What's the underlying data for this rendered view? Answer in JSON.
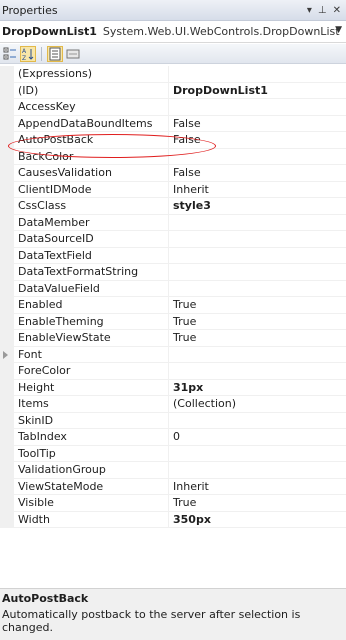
{
  "window": {
    "title": "Properties"
  },
  "object_selector": {
    "name": "DropDownList1",
    "type": "System.Web.UI.WebControls.DropDownList"
  },
  "toolbar": {
    "buttons": [
      {
        "icon": "categorized-icon"
      },
      {
        "icon": "alphabetical-icon"
      },
      {
        "icon": "properties-icon"
      },
      {
        "icon": "events-icon"
      }
    ]
  },
  "properties": [
    {
      "name": "(Expressions)",
      "value": ""
    },
    {
      "name": "(ID)",
      "value": "DropDownList1",
      "bold": true
    },
    {
      "name": "AccessKey",
      "value": ""
    },
    {
      "name": "AppendDataBoundItems",
      "value": "False"
    },
    {
      "name": "AutoPostBack",
      "value": "False",
      "selected": true
    },
    {
      "name": "BackColor",
      "value": ""
    },
    {
      "name": "CausesValidation",
      "value": "False"
    },
    {
      "name": "ClientIDMode",
      "value": "Inherit"
    },
    {
      "name": "CssClass",
      "value": "style3",
      "bold": true
    },
    {
      "name": "DataMember",
      "value": ""
    },
    {
      "name": "DataSourceID",
      "value": ""
    },
    {
      "name": "DataTextField",
      "value": ""
    },
    {
      "name": "DataTextFormatString",
      "value": ""
    },
    {
      "name": "DataValueField",
      "value": ""
    },
    {
      "name": "Enabled",
      "value": "True"
    },
    {
      "name": "EnableTheming",
      "value": "True"
    },
    {
      "name": "EnableViewState",
      "value": "True"
    },
    {
      "name": "Font",
      "value": "",
      "expandable": true
    },
    {
      "name": "ForeColor",
      "value": ""
    },
    {
      "name": "Height",
      "value": "31px",
      "bold": true
    },
    {
      "name": "Items",
      "value": "(Collection)"
    },
    {
      "name": "SkinID",
      "value": ""
    },
    {
      "name": "TabIndex",
      "value": "0"
    },
    {
      "name": "ToolTip",
      "value": ""
    },
    {
      "name": "ValidationGroup",
      "value": ""
    },
    {
      "name": "ViewStateMode",
      "value": "Inherit"
    },
    {
      "name": "Visible",
      "value": "True"
    },
    {
      "name": "Width",
      "value": "350px",
      "bold": true
    }
  ],
  "description": {
    "title": "AutoPostBack",
    "text": "Automatically postback to the server after selection is changed."
  },
  "colors": {
    "annotation": "#e01e1e",
    "gutter": "#f0f0f0",
    "active_button": "#f7e6a9"
  }
}
